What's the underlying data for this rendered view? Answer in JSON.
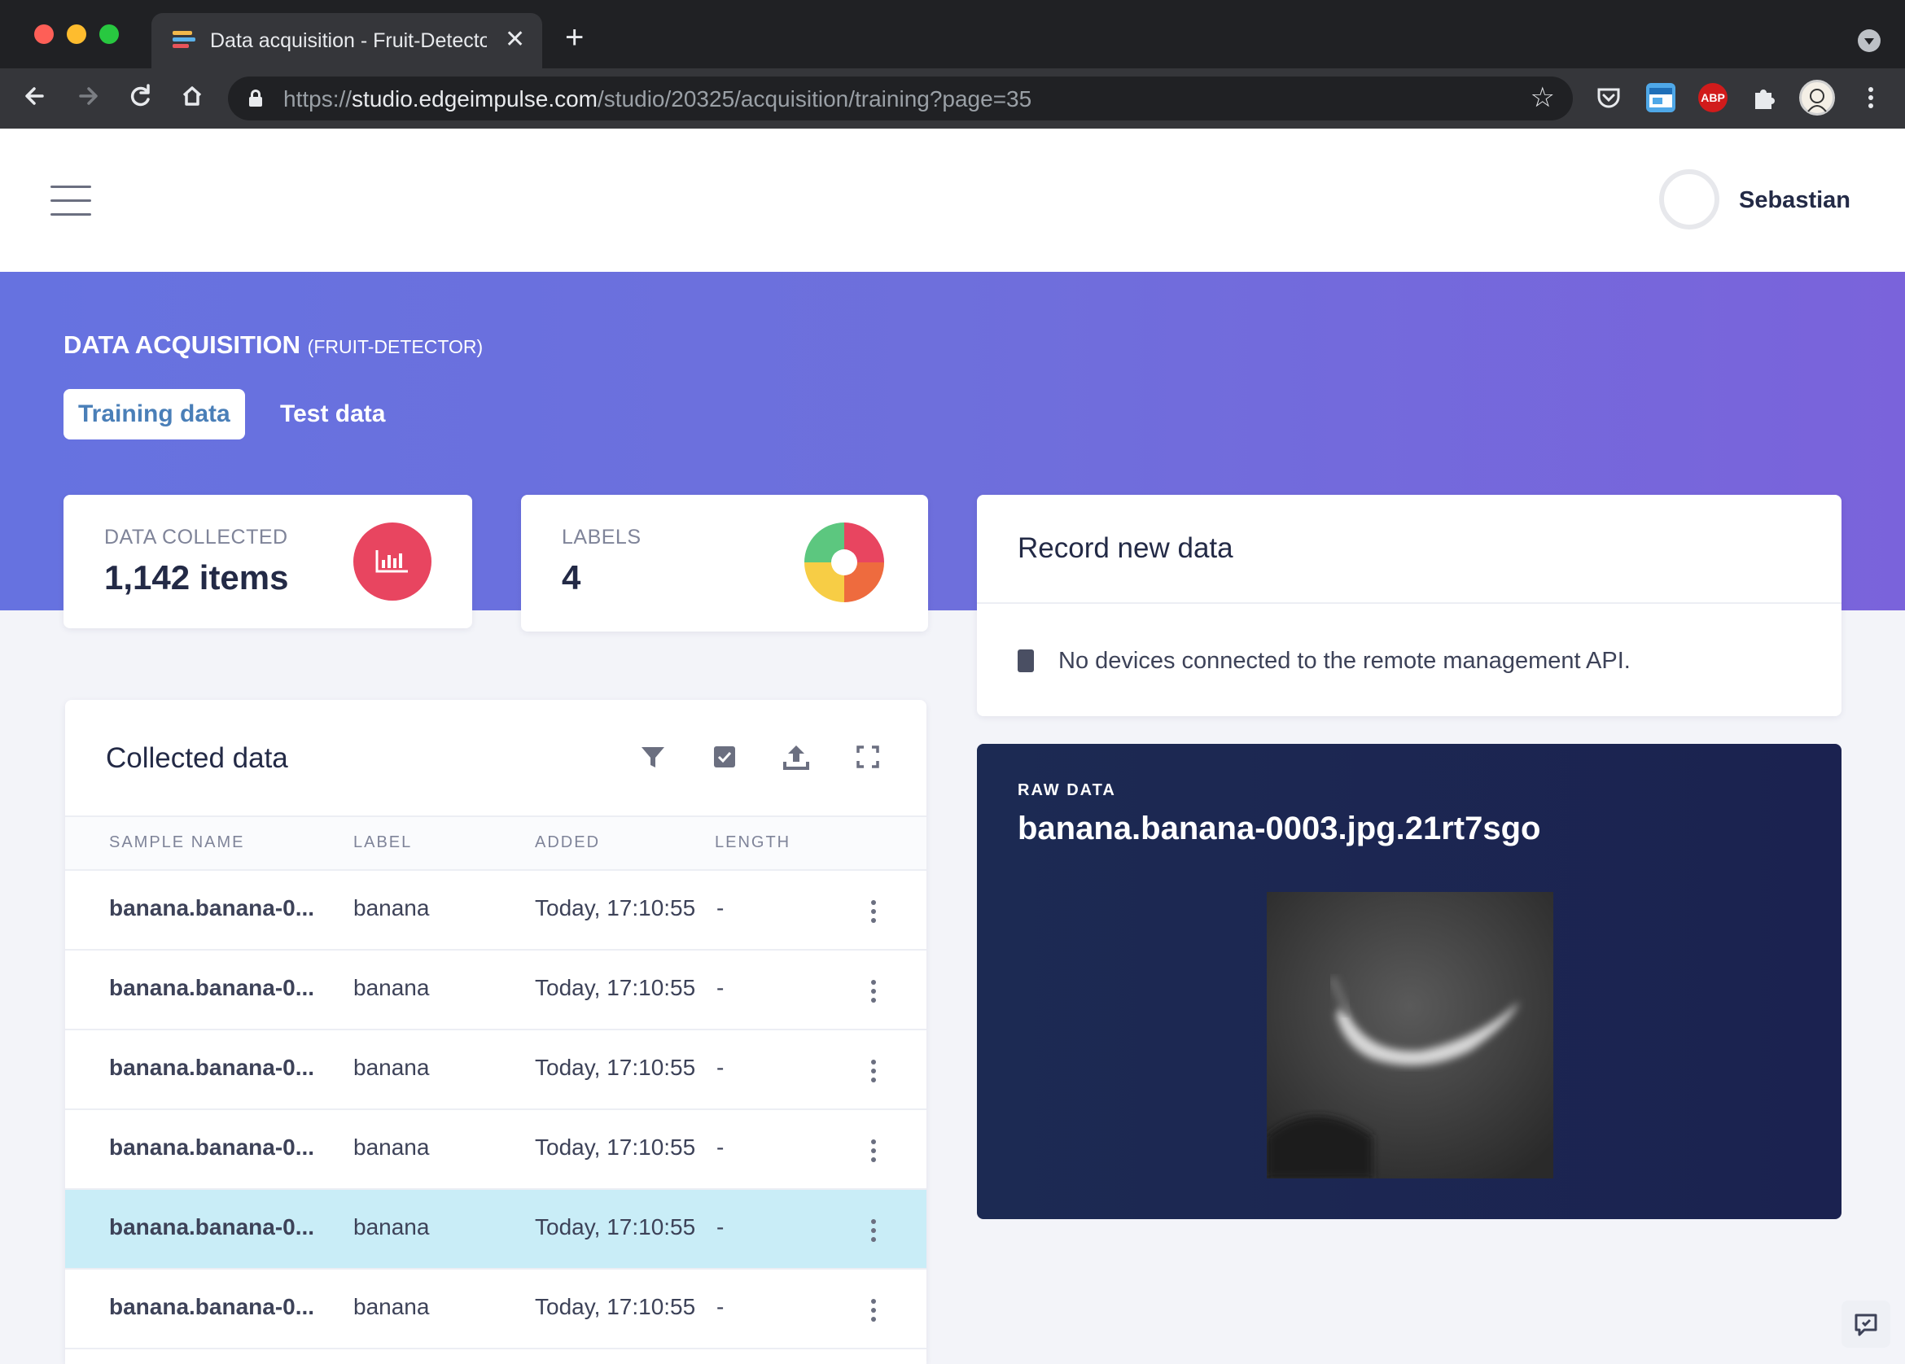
{
  "browser": {
    "tab_title": "Data acquisition - Fruit-Detector",
    "tab_close": "✕",
    "new_tab": "+",
    "url_scheme": "https://",
    "url_host": "studio.edgeimpulse.com",
    "url_path": "/studio/20325/acquisition/training?page=35",
    "extensions": {
      "abp_label": "ABP"
    }
  },
  "header": {
    "user_name": "Sebastian"
  },
  "page": {
    "title": "DATA ACQUISITION",
    "project": "(FRUIT-DETECTOR)",
    "tabs": [
      {
        "label": "Training data",
        "active": true
      },
      {
        "label": "Test data",
        "active": false
      }
    ]
  },
  "stats": {
    "data_collected": {
      "label": "DATA COLLECTED",
      "value": "1,142 items",
      "icon": "bar-chart-icon",
      "color": "#e84560"
    },
    "labels": {
      "label": "LABELS",
      "value": "4",
      "icon": "pie-chart-icon"
    }
  },
  "record": {
    "title": "Record new data",
    "message": "No devices connected to the remote management API."
  },
  "collected": {
    "title": "Collected data",
    "columns": [
      "SAMPLE NAME",
      "LABEL",
      "ADDED",
      "LENGTH"
    ],
    "rows": [
      {
        "name": "banana.banana-0...",
        "label": "banana",
        "added": "Today, 17:10:55",
        "length": "-",
        "selected": false
      },
      {
        "name": "banana.banana-0...",
        "label": "banana",
        "added": "Today, 17:10:55",
        "length": "-",
        "selected": false
      },
      {
        "name": "banana.banana-0...",
        "label": "banana",
        "added": "Today, 17:10:55",
        "length": "-",
        "selected": false
      },
      {
        "name": "banana.banana-0...",
        "label": "banana",
        "added": "Today, 17:10:55",
        "length": "-",
        "selected": false
      },
      {
        "name": "banana.banana-0...",
        "label": "banana",
        "added": "Today, 17:10:55",
        "length": "-",
        "selected": true
      },
      {
        "name": "banana.banana-0...",
        "label": "banana",
        "added": "Today, 17:10:55",
        "length": "-",
        "selected": false
      }
    ]
  },
  "raw": {
    "label": "RAW DATA",
    "name": "banana.banana-0003.jpg.21rt7sgo"
  },
  "colors": {
    "accent": "#4a7fb8",
    "hero_start": "#6672e0",
    "hero_end": "#7a63db",
    "selected_row": "#c9edf7",
    "raw_bg": "#1c2a53"
  }
}
